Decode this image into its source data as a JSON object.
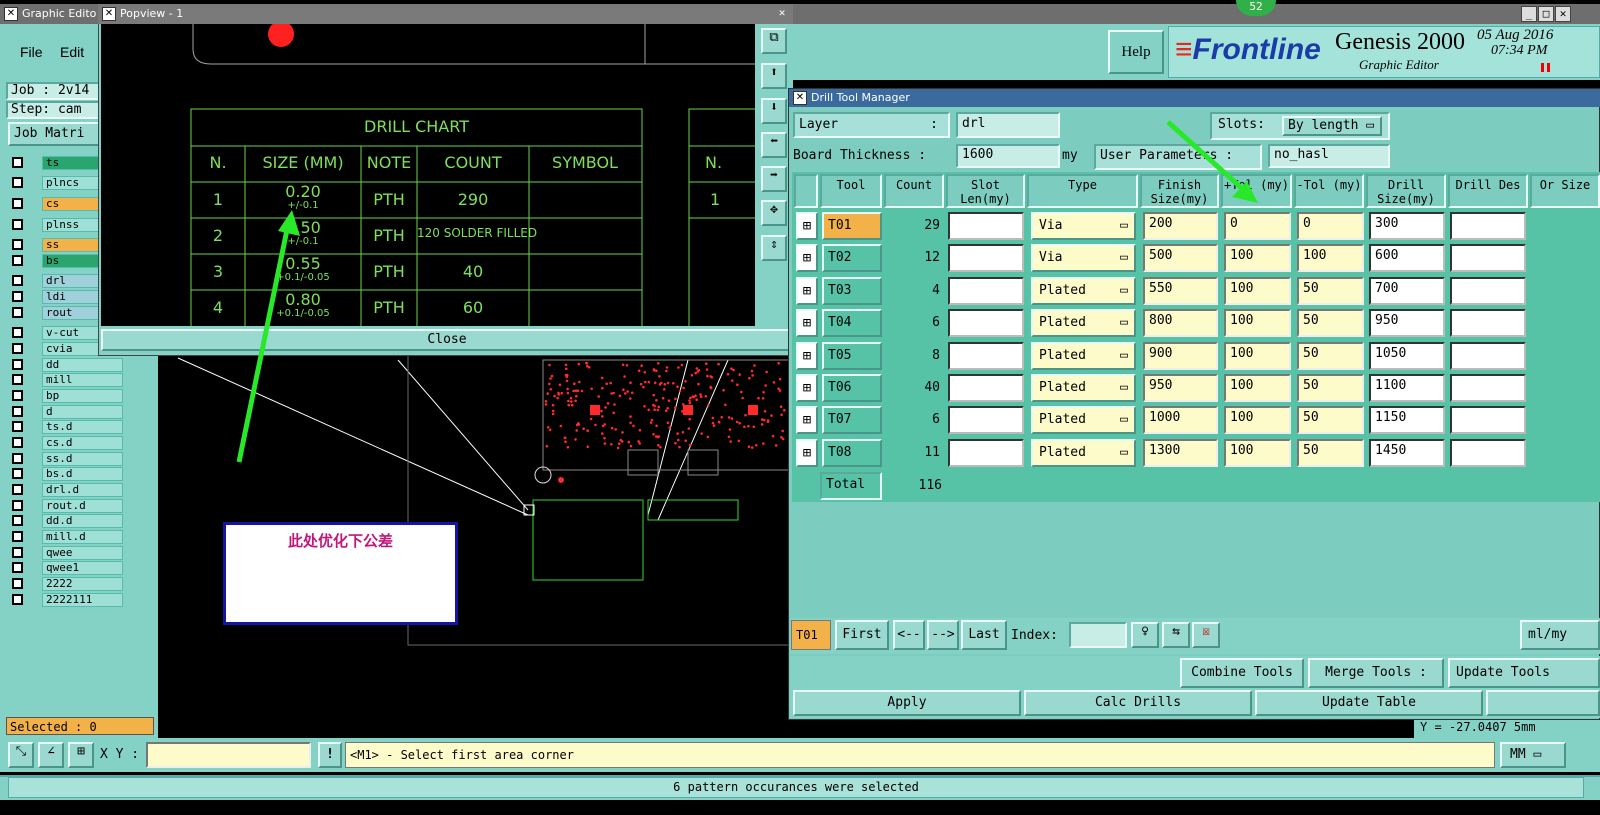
{
  "graphic_editor": {
    "title": "Graphic Edito",
    "menu": [
      "File",
      "Edit"
    ],
    "job": "Job : 2v14",
    "step": "Step: cam",
    "job_matrix": "Job Matri",
    "selected": "Selected : 0",
    "help": "Help",
    "brand": "Frontline",
    "product": "Genesis 2000",
    "module": "Graphic Editor",
    "date": "05 Aug 2016",
    "time": "07:34 PM",
    "badge": "52",
    "xy_label": "X Y :",
    "prompt": "<M1> - Select first area corner",
    "status": "6 pattern occurances were selected",
    "unit": "MM",
    "ycoord": "Y = -27.0407 5mm"
  },
  "layers": [
    {
      "name": "ts",
      "color": "#2aa56e"
    },
    {
      "name": "plncs",
      "color": "#9fe0d6"
    },
    {
      "name": "cs",
      "color": "#f3b14a"
    },
    {
      "name": "plnss",
      "color": "#9fe0d6"
    },
    {
      "name": "ss",
      "color": "#f3b14a"
    },
    {
      "name": "bs",
      "color": "#2aa56e"
    },
    {
      "name": "drl",
      "color": "#9fd0dc"
    },
    {
      "name": "ldi",
      "color": "#9fd0dc"
    },
    {
      "name": "rout",
      "color": "#9fd0dc"
    },
    {
      "name": "v-cut",
      "color": "#9fe0d6"
    },
    {
      "name": "cvia",
      "color": "#9fe0d6"
    },
    {
      "name": "dd",
      "color": "#9fe0d6"
    },
    {
      "name": "mill",
      "color": "#9fe0d6"
    },
    {
      "name": "bp",
      "color": "#9fe0d6"
    },
    {
      "name": "d",
      "color": "#9fe0d6"
    },
    {
      "name": "ts.d",
      "color": "#9fe0d6"
    },
    {
      "name": "cs.d",
      "color": "#9fe0d6"
    },
    {
      "name": "ss.d",
      "color": "#9fe0d6"
    },
    {
      "name": "bs.d",
      "color": "#9fe0d6"
    },
    {
      "name": "drl.d",
      "color": "#9fe0d6"
    },
    {
      "name": "rout.d",
      "color": "#9fe0d6"
    },
    {
      "name": "dd.d",
      "color": "#9fe0d6"
    },
    {
      "name": "mill.d",
      "color": "#9fe0d6"
    },
    {
      "name": "qwee",
      "color": "#9fe0d6"
    },
    {
      "name": "qwee1",
      "color": "#9fe0d6"
    },
    {
      "name": "2222",
      "color": "#9fe0d6"
    },
    {
      "name": "2222111",
      "color": "#9fe0d6"
    }
  ],
  "popview": {
    "title": "Popview - 1",
    "close": "Close",
    "chart_title": "DRILL CHART",
    "headers": [
      "N.",
      "SIZE (MM)",
      "NOTE",
      "COUNT",
      "SYMBOL"
    ],
    "rows": [
      {
        "n": "1",
        "size": "0.20",
        "tol": "+/-0.1",
        "note": "PTH",
        "count": "290"
      },
      {
        "n": "2",
        "size": "0.50",
        "tol": "+/-0.1",
        "note": "PTH",
        "count": "120 SOLDER FILLED"
      },
      {
        "n": "3",
        "size": "0.55",
        "tol": "+0.1/-0.05",
        "note": "PTH",
        "count": "40"
      },
      {
        "n": "4",
        "size": "0.80",
        "tol": "+0.1/-0.05",
        "note": "PTH",
        "count": "60"
      }
    ],
    "right_n": "N.",
    "right_1": "1"
  },
  "annotation": "此处优化下公差",
  "drill_manager": {
    "title": "Drill Tool Manager",
    "layer_label": "Layer",
    "layer_value": "drl",
    "slots_label": "Slots:",
    "slots_value": "By length",
    "thickness_label": "Board Thickness :",
    "thickness_value": "1600",
    "thickness_unit": "my",
    "user_params": "User Parameters :",
    "user_params_value": "no_hasl",
    "headers": [
      "Tool",
      "Count",
      "Slot Len(my)",
      "Type",
      "Finish Size(my)",
      "+Tol (my)",
      "-Tol (my)",
      "Drill Size(my)",
      "Drill Des",
      "Or Size"
    ],
    "rows": [
      {
        "tool": "T01",
        "count": "29",
        "type": "Via",
        "finish": "200",
        "ptol": "0",
        "mtol": "0",
        "drill": "300"
      },
      {
        "tool": "T02",
        "count": "12",
        "type": "Via",
        "finish": "500",
        "ptol": "100",
        "mtol": "100",
        "drill": "600"
      },
      {
        "tool": "T03",
        "count": "4",
        "type": "Plated",
        "finish": "550",
        "ptol": "100",
        "mtol": "50",
        "drill": "700"
      },
      {
        "tool": "T04",
        "count": "6",
        "type": "Plated",
        "finish": "800",
        "ptol": "100",
        "mtol": "50",
        "drill": "950"
      },
      {
        "tool": "T05",
        "count": "8",
        "type": "Plated",
        "finish": "900",
        "ptol": "100",
        "mtol": "50",
        "drill": "1050"
      },
      {
        "tool": "T06",
        "count": "40",
        "type": "Plated",
        "finish": "950",
        "ptol": "100",
        "mtol": "50",
        "drill": "1100"
      },
      {
        "tool": "T07",
        "count": "6",
        "type": "Plated",
        "finish": "1000",
        "ptol": "100",
        "mtol": "50",
        "drill": "1150"
      },
      {
        "tool": "T08",
        "count": "11",
        "type": "Plated",
        "finish": "1300",
        "ptol": "100",
        "mtol": "50",
        "drill": "1450"
      }
    ],
    "total_label": "Total",
    "total_count": "116",
    "current": "T01",
    "first": "First",
    "prev": "<--",
    "next": "-->",
    "last": "Last",
    "index": "Index:",
    "units": "ml/my",
    "combine": "Combine Tools",
    "merge": "Merge Tools :",
    "update_tools": "Update Tools",
    "apply": "Apply",
    "calc": "Calc Drills",
    "update_table": "Update Table"
  }
}
